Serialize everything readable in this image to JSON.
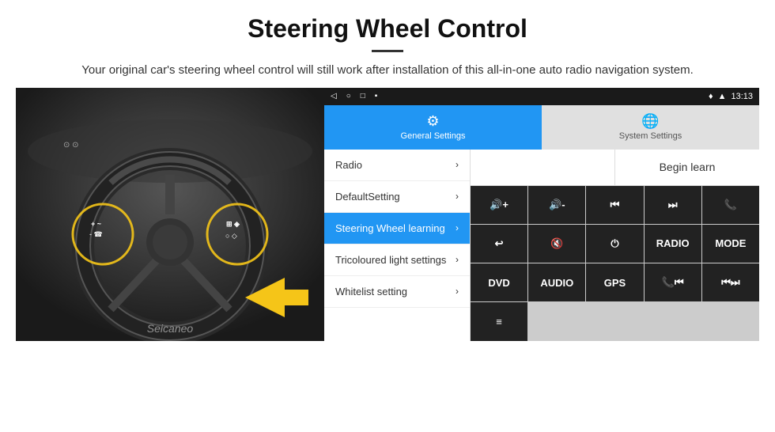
{
  "header": {
    "title": "Steering Wheel Control",
    "description": "Your original car's steering wheel control will still work after installation of this all-in-one auto radio navigation system."
  },
  "status_bar": {
    "time": "13:13",
    "left_icons": [
      "◁",
      "○",
      "□",
      "⬜"
    ],
    "right_icons": [
      "♦",
      "▲"
    ]
  },
  "tabs": [
    {
      "id": "general",
      "label": "General Settings",
      "icon": "⚙",
      "active": true
    },
    {
      "id": "system",
      "label": "System Settings",
      "icon": "🌐",
      "active": false
    }
  ],
  "menu_items": [
    {
      "label": "Radio",
      "active": false
    },
    {
      "label": "DefaultSetting",
      "active": false
    },
    {
      "label": "Steering Wheel learning",
      "active": true
    },
    {
      "label": "Tricoloured light settings",
      "active": false
    },
    {
      "label": "Whitelist setting",
      "active": false
    }
  ],
  "begin_learn_label": "Begin learn",
  "control_buttons": [
    {
      "label": "🔊+",
      "row": 1,
      "col": 1
    },
    {
      "label": "🔊-",
      "row": 1,
      "col": 2
    },
    {
      "label": "⏮",
      "row": 1,
      "col": 3
    },
    {
      "label": "⏭",
      "row": 1,
      "col": 4
    },
    {
      "label": "📞",
      "row": 1,
      "col": 5
    },
    {
      "label": "↩",
      "row": 2,
      "col": 1
    },
    {
      "label": "🔇",
      "row": 2,
      "col": 2
    },
    {
      "label": "⏻",
      "row": 2,
      "col": 3
    },
    {
      "label": "RADIO",
      "row": 2,
      "col": 4
    },
    {
      "label": "MODE",
      "row": 2,
      "col": 5
    },
    {
      "label": "DVD",
      "row": 3,
      "col": 1
    },
    {
      "label": "AUDIO",
      "row": 3,
      "col": 2
    },
    {
      "label": "GPS",
      "row": 3,
      "col": 3
    },
    {
      "label": "📞⏮",
      "row": 3,
      "col": 4
    },
    {
      "label": "⏮⏭",
      "row": 3,
      "col": 5
    },
    {
      "label": "≡",
      "row": 4,
      "col": 1
    }
  ],
  "watermark": "Seicaneo"
}
